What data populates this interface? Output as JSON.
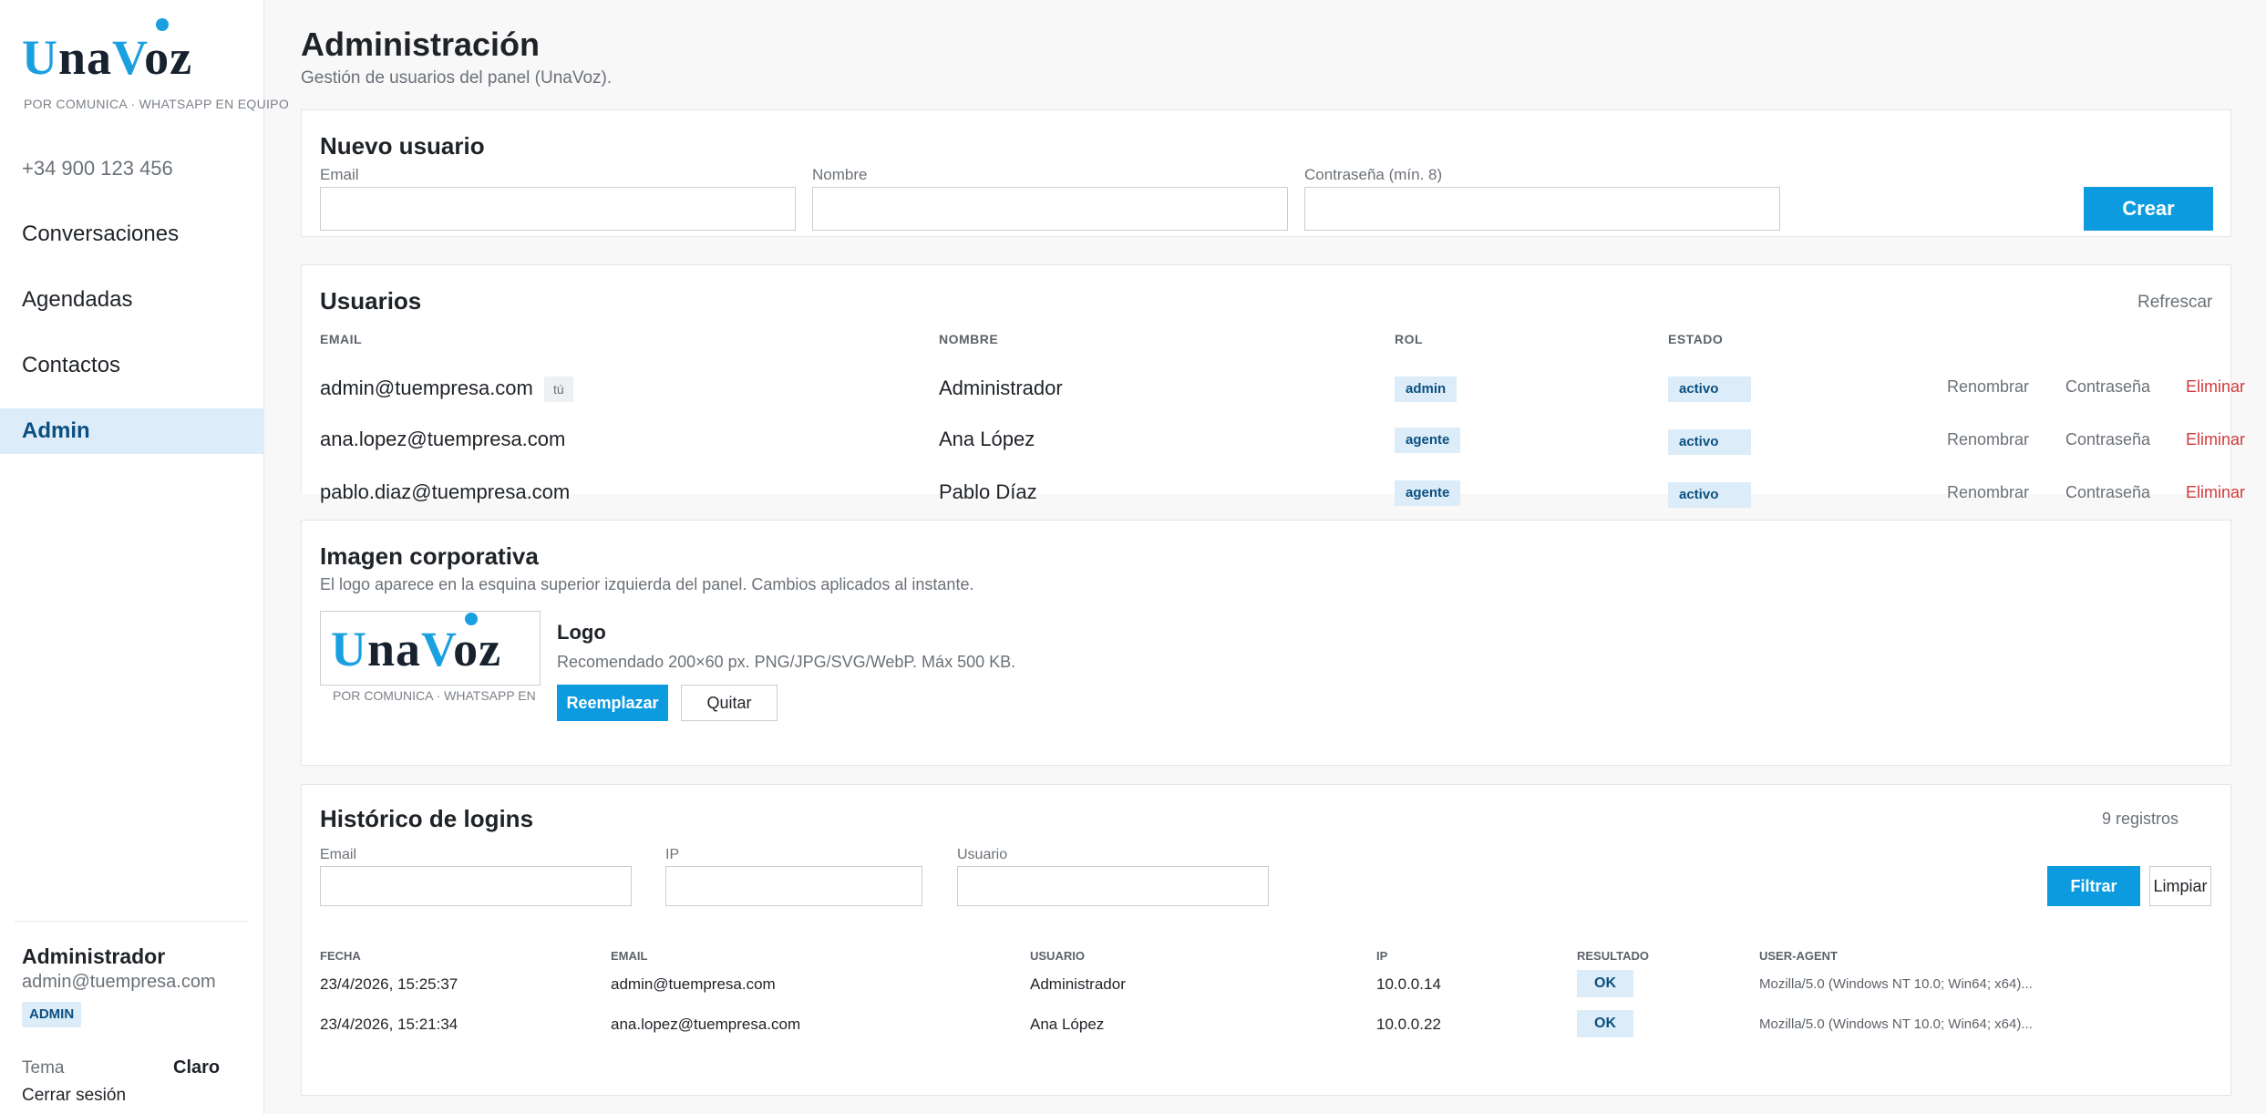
{
  "brand": {
    "logo_letters": [
      "U",
      "na",
      "V",
      "oz"
    ],
    "tagline_left": "POR COMUNICA",
    "tagline_sep": "·",
    "tagline_right": "WHATSAPP EN EQUIPO",
    "accent_color": "#1aa0e1"
  },
  "sidebar": {
    "phone": "+34 900 123 456",
    "items": [
      {
        "label": "Conversaciones"
      },
      {
        "label": "Agendadas"
      },
      {
        "label": "Contactos"
      },
      {
        "label": "Admin",
        "active": true
      }
    ],
    "user": {
      "name": "Administrador",
      "email": "admin@tuempresa.com",
      "role": "ADMIN"
    },
    "theme_label": "Tema",
    "theme_value": "Claro",
    "logout": "Cerrar sesión"
  },
  "header": {
    "title": "Administración",
    "subtitle": "Gestión de usuarios del panel (UnaVoz)."
  },
  "new_user": {
    "title": "Nuevo usuario",
    "email_label": "Email",
    "name_label": "Nombre",
    "password_label": "Contraseña (mín. 8)",
    "create_button": "Crear"
  },
  "users": {
    "title": "Usuarios",
    "refresh": "Refrescar",
    "columns": [
      "EMAIL",
      "NOMBRE",
      "ROL",
      "ESTADO"
    ],
    "you_tag": "tú",
    "actions": {
      "rename": "Renombrar",
      "password": "Contraseña",
      "delete": "Eliminar"
    },
    "rows": [
      {
        "email": "admin@tuempresa.com",
        "name": "Administrador",
        "role": "admin",
        "status": "activo"
      },
      {
        "email": "ana.lopez@tuempresa.com",
        "name": "Ana López",
        "role": "agente",
        "status": "activo"
      },
      {
        "email": "pablo.diaz@tuempresa.com",
        "name": "Pablo Díaz",
        "role": "agente",
        "status": "activo"
      }
    ]
  },
  "branding": {
    "title": "Imagen corporativa",
    "description": "El logo aparece en la esquina superior izquierda del panel. Cambios aplicados al instante.",
    "logo_title": "Logo",
    "logo_hint": "Recomendado 200×60 px. PNG/JPG/SVG/WebP. Máx 500 KB.",
    "replace_button": "Reemplazar",
    "remove_button": "Quitar"
  },
  "logins": {
    "title": "Histórico de logins",
    "count": "9 registros",
    "email_label": "Email",
    "ip_label": "IP",
    "user_label": "Usuario",
    "filter_button": "Filtrar",
    "clear_button": "Limpiar",
    "columns": [
      "FECHA",
      "EMAIL",
      "USUARIO",
      "IP",
      "RESULTADO",
      "USER-AGENT"
    ],
    "rows": [
      {
        "date": "23/4/2026, 15:25:37",
        "email": "admin@tuempresa.com",
        "user": "Administrador",
        "ip": "10.0.0.14",
        "result": "OK",
        "ua": "Mozilla/5.0 (Windows NT 10.0; Win64; x64)..."
      },
      {
        "date": "23/4/2026, 15:21:34",
        "email": "ana.lopez@tuempresa.com",
        "user": "Ana López",
        "ip": "10.0.0.22",
        "result": "OK",
        "ua": "Mozilla/5.0 (Windows NT 10.0; Win64; x64)..."
      }
    ]
  }
}
